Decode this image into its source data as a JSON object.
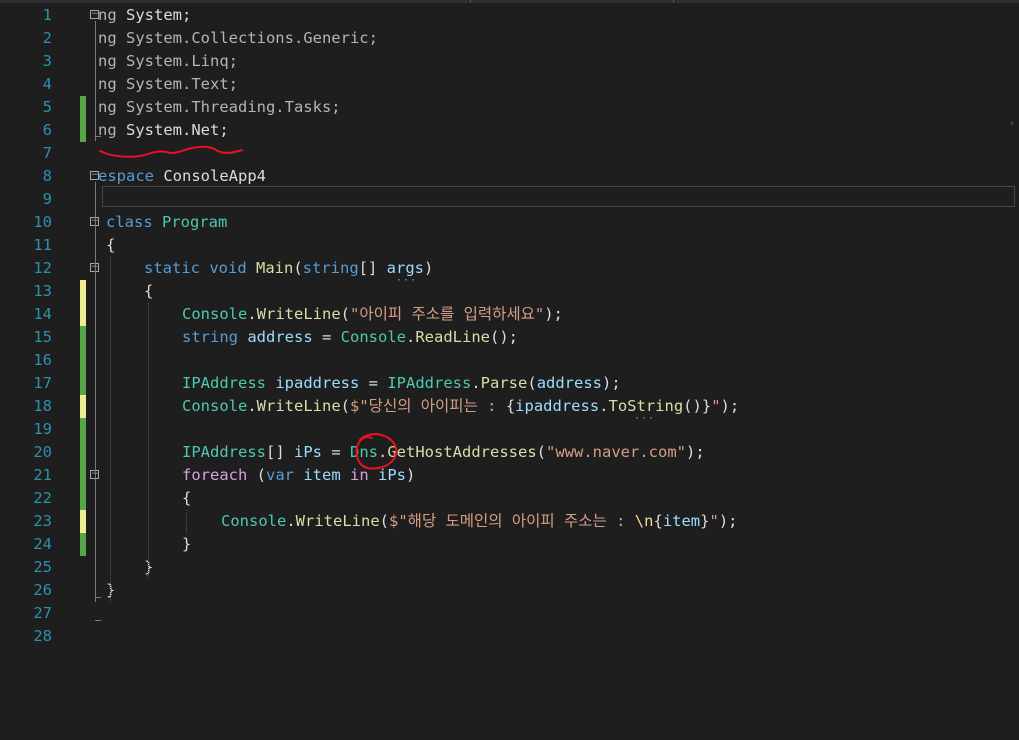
{
  "editor": {
    "lines": [
      {
        "n": "1",
        "segs": [
          [
            "ng ",
            "dim"
          ],
          [
            "System",
            "pl"
          ],
          [
            ";",
            "pl"
          ]
        ]
      },
      {
        "n": "2",
        "segs": [
          [
            "ng ",
            "dim"
          ],
          [
            "System.Collections.Generic;",
            "dim"
          ]
        ]
      },
      {
        "n": "3",
        "segs": [
          [
            "ng ",
            "dim"
          ],
          [
            "System.Linq;",
            "dim"
          ]
        ]
      },
      {
        "n": "4",
        "segs": [
          [
            "ng ",
            "dim"
          ],
          [
            "System.Text;",
            "dim"
          ]
        ]
      },
      {
        "n": "5",
        "segs": [
          [
            "ng ",
            "dim"
          ],
          [
            "System.Threading.Tasks;",
            "dim"
          ]
        ]
      },
      {
        "n": "6",
        "segs": [
          [
            "ng ",
            "dim"
          ],
          [
            "System",
            "pl"
          ],
          [
            ".",
            "pl"
          ],
          [
            "Net",
            "pl"
          ],
          [
            ";",
            "pl"
          ]
        ]
      },
      {
        "n": "7",
        "segs": []
      },
      {
        "n": "8",
        "segs": [
          [
            "espace ",
            "kw"
          ],
          [
            "ConsoleApp4",
            "pl"
          ]
        ]
      },
      {
        "n": "9",
        "segs": []
      },
      {
        "n": "10",
        "segs": [
          [
            "class ",
            "kw"
          ],
          [
            "Program",
            "ty"
          ]
        ]
      },
      {
        "n": "11",
        "segs": [
          [
            "{",
            "pl"
          ]
        ]
      },
      {
        "n": "12",
        "segs": [
          [
            "static ",
            "kw"
          ],
          [
            "void ",
            "kw"
          ],
          [
            "Main",
            "mt"
          ],
          [
            "(",
            "pl"
          ],
          [
            "string",
            "kw"
          ],
          [
            "[] ",
            "pl"
          ],
          [
            "args",
            "va"
          ],
          [
            ")",
            "pl"
          ]
        ]
      },
      {
        "n": "13",
        "segs": [
          [
            "{",
            "pl"
          ]
        ]
      },
      {
        "n": "14",
        "segs": [
          [
            "Console",
            "ty"
          ],
          [
            ".",
            "pl"
          ],
          [
            "WriteLine",
            "mt"
          ],
          [
            "(",
            "pl"
          ],
          [
            "\"아이피 주소를 입력하세요\"",
            "st"
          ],
          [
            ");",
            "pl"
          ]
        ]
      },
      {
        "n": "15",
        "segs": [
          [
            "string ",
            "kw"
          ],
          [
            "address",
            "va"
          ],
          [
            " = ",
            "pl"
          ],
          [
            "Console",
            "ty"
          ],
          [
            ".",
            "pl"
          ],
          [
            "ReadLine",
            "mt"
          ],
          [
            "();",
            "pl"
          ]
        ]
      },
      {
        "n": "16",
        "segs": []
      },
      {
        "n": "17",
        "segs": [
          [
            "IPAddress ",
            "ty"
          ],
          [
            "ipaddress",
            "va"
          ],
          [
            " = ",
            "pl"
          ],
          [
            "IPAddress",
            "ty"
          ],
          [
            ".",
            "pl"
          ],
          [
            "Parse",
            "mt"
          ],
          [
            "(",
            "pl"
          ],
          [
            "address",
            "va"
          ],
          [
            ");",
            "pl"
          ]
        ]
      },
      {
        "n": "18",
        "segs": [
          [
            "Console",
            "ty"
          ],
          [
            ".",
            "pl"
          ],
          [
            "WriteLine",
            "mt"
          ],
          [
            "(",
            "pl"
          ],
          [
            "$\"당신의 아이피는 : ",
            "st"
          ],
          [
            "{",
            "pl"
          ],
          [
            "ipaddress",
            "va"
          ],
          [
            ".",
            "pl"
          ],
          [
            "ToString",
            "mt"
          ],
          [
            "()",
            "pl"
          ],
          [
            "}",
            "pl"
          ],
          [
            "\"",
            "st"
          ],
          [
            ");",
            "pl"
          ]
        ]
      },
      {
        "n": "19",
        "segs": []
      },
      {
        "n": "20",
        "segs": [
          [
            "IPAddress",
            "ty"
          ],
          [
            "[] ",
            "pl"
          ],
          [
            "iPs",
            "va"
          ],
          [
            " = ",
            "pl"
          ],
          [
            "Dns",
            "ty"
          ],
          [
            ".",
            "pl"
          ],
          [
            "GetHostAddresses",
            "mt"
          ],
          [
            "(",
            "pl"
          ],
          [
            "\"www.naver.com\"",
            "st"
          ],
          [
            ");",
            "pl"
          ]
        ]
      },
      {
        "n": "21",
        "segs": [
          [
            "foreach ",
            "ctl"
          ],
          [
            "(",
            "pl"
          ],
          [
            "var ",
            "kw"
          ],
          [
            "item ",
            "va"
          ],
          [
            "in ",
            "ctl"
          ],
          [
            "iPs",
            "va"
          ],
          [
            ")",
            "pl"
          ]
        ]
      },
      {
        "n": "22",
        "segs": [
          [
            "{",
            "pl"
          ]
        ]
      },
      {
        "n": "23",
        "segs": [
          [
            "Console",
            "ty"
          ],
          [
            ".",
            "pl"
          ],
          [
            "WriteLine",
            "mt"
          ],
          [
            "(",
            "pl"
          ],
          [
            "$\"해당 도메인의 아이피 주소는 : ",
            "st"
          ],
          [
            "\\n",
            "esc"
          ],
          [
            "{",
            "pl"
          ],
          [
            "item",
            "va"
          ],
          [
            "}",
            "pl"
          ],
          [
            "\"",
            "st"
          ],
          [
            ");",
            "pl"
          ]
        ]
      },
      {
        "n": "24",
        "segs": [
          [
            "}",
            "pl"
          ]
        ]
      },
      {
        "n": "25",
        "segs": [
          [
            "}",
            "pl"
          ]
        ]
      },
      {
        "n": "26",
        "segs": [
          [
            "}",
            "pl"
          ]
        ]
      },
      {
        "n": "27",
        "segs": []
      },
      {
        "n": "28",
        "segs": []
      }
    ]
  },
  "colors": {
    "background": "#1e1e1e",
    "line_number": "#2b91af",
    "saved_change": "#57a64a",
    "unsaved_change": "#efef91",
    "annotation": "#e81123"
  }
}
